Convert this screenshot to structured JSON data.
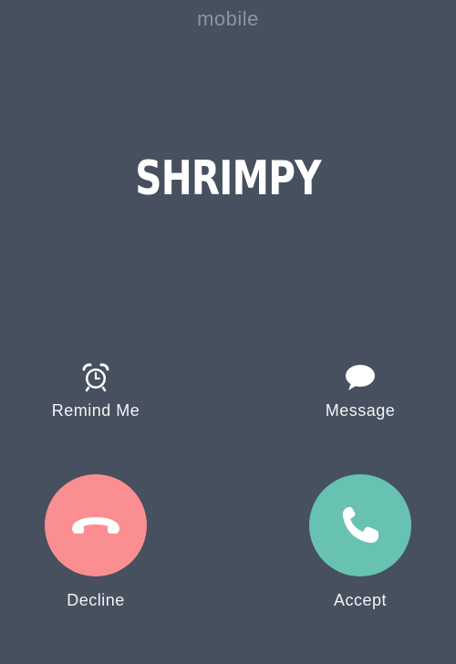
{
  "top_label": "mobile",
  "caller": {
    "name": "SHRIMPY"
  },
  "actions": {
    "remind": {
      "label": "Remind Me",
      "icon": "alarm-clock-icon"
    },
    "message": {
      "label": "Message",
      "icon": "speech-bubble-icon"
    }
  },
  "buttons": {
    "decline": {
      "label": "Decline",
      "icon": "phone-hangup-icon",
      "color": "#fb8e91"
    },
    "accept": {
      "label": "Accept",
      "icon": "phone-icon",
      "color": "#67c2b2"
    }
  },
  "colors": {
    "background": "#46505e",
    "text": "#ffffff"
  }
}
